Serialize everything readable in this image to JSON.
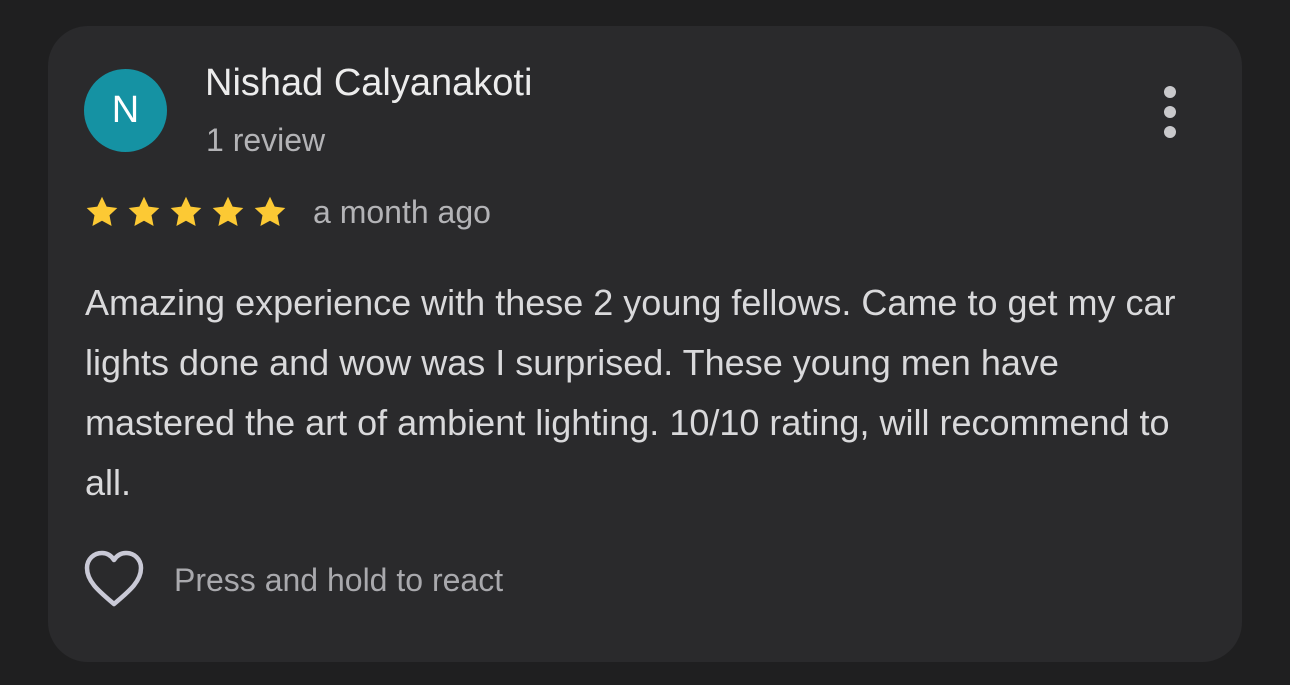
{
  "review": {
    "avatar_initial": "N",
    "avatar_color": "#1592a3",
    "reviewer_name": "Nishad Calyanakoti",
    "review_count": "1 review",
    "rating": 5,
    "rating_max": 5,
    "star_color": "#fcc934",
    "date": "a month ago",
    "text": "Amazing experience with these 2 young fellows. Came to get my car lights done and wow was I surprised. These young men have mastered the art of ambient lighting. 10/10 rating, will recommend to all.",
    "more_icon": "more-vert-icon",
    "react_icon": "heart-outline-icon",
    "react_label": "Press and hold to react"
  }
}
